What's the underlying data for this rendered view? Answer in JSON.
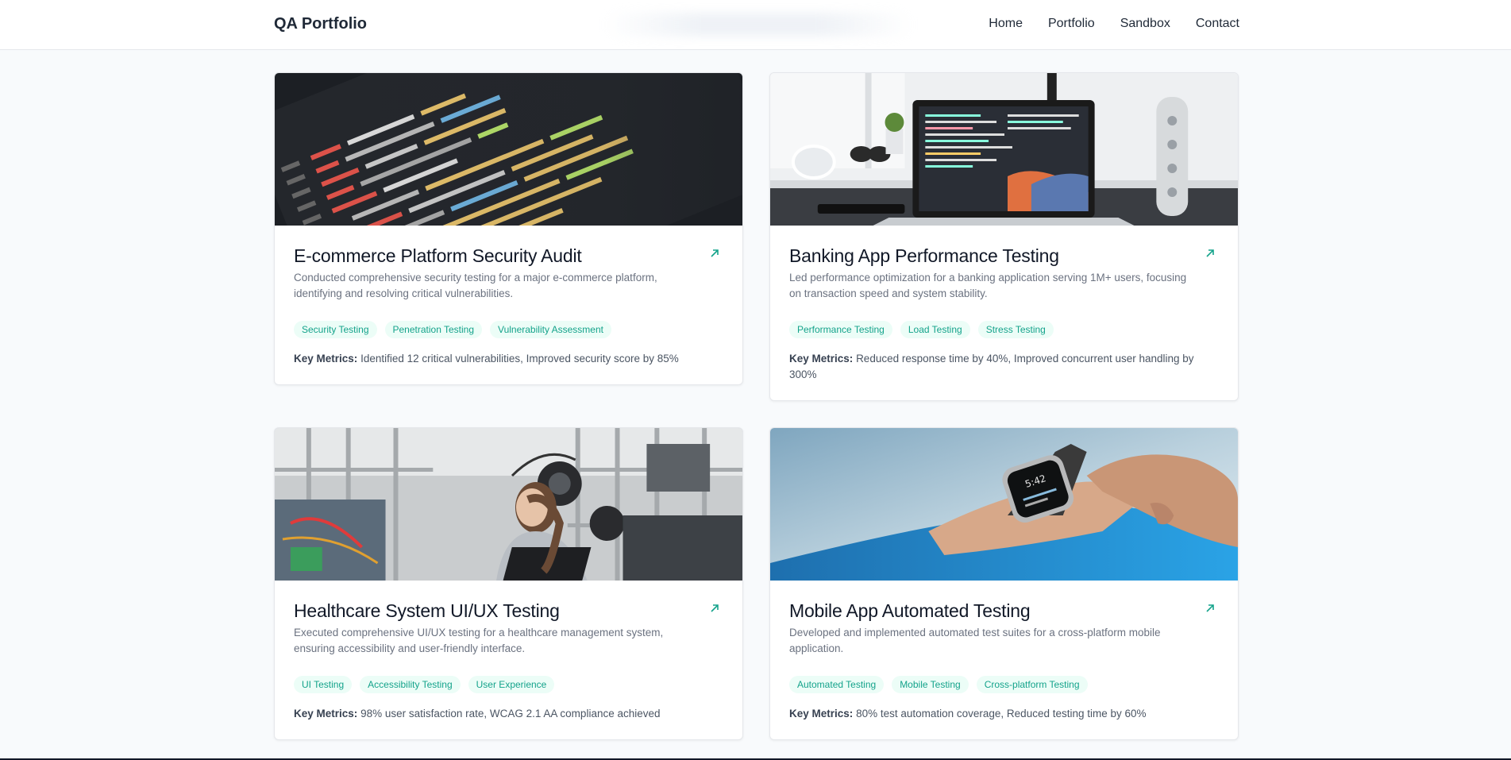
{
  "nav": {
    "brand": "QA Portfolio",
    "links": [
      "Home",
      "Portfolio",
      "Sandbox",
      "Contact"
    ]
  },
  "projects": [
    {
      "title": "E-commerce Platform Security Audit",
      "description": "Conducted comprehensive security testing for a major e-commerce platform, identifying and resolving critical vulnerabilities.",
      "tags": [
        "Security Testing",
        "Penetration Testing",
        "Vulnerability Assessment"
      ],
      "metrics_label": "Key Metrics:",
      "metrics": "Identified 12 critical vulnerabilities, Improved security score by 85%",
      "image": "code-editor-photo"
    },
    {
      "title": "Banking App Performance Testing",
      "description": "Led performance optimization for a banking application serving 1M+ users, focusing on transaction speed and system stability.",
      "tags": [
        "Performance Testing",
        "Load Testing",
        "Stress Testing"
      ],
      "metrics_label": "Key Metrics:",
      "metrics": "Reduced response time by 40%, Improved concurrent user handling by 300%",
      "image": "laptop-desk-photo"
    },
    {
      "title": "Healthcare System UI/UX Testing",
      "description": "Executed comprehensive UI/UX testing for a healthcare management system, ensuring accessibility and user-friendly interface.",
      "tags": [
        "UI Testing",
        "Accessibility Testing",
        "User Experience"
      ],
      "metrics_label": "Key Metrics:",
      "metrics": "98% user satisfaction rate, WCAG 2.1 AA compliance achieved",
      "image": "lab-engineer-photo"
    },
    {
      "title": "Mobile App Automated Testing",
      "description": "Developed and implemented automated test suites for a cross-platform mobile application.",
      "tags": [
        "Automated Testing",
        "Mobile Testing",
        "Cross-platform Testing"
      ],
      "metrics_label": "Key Metrics:",
      "metrics": "80% test automation coverage, Reduced testing time by 60%",
      "image": "smartwatch-photo"
    }
  ],
  "colors": {
    "accent": "#14a38b",
    "tag_bg": "#ecfdf7",
    "page_bg": "#f8fafc"
  }
}
